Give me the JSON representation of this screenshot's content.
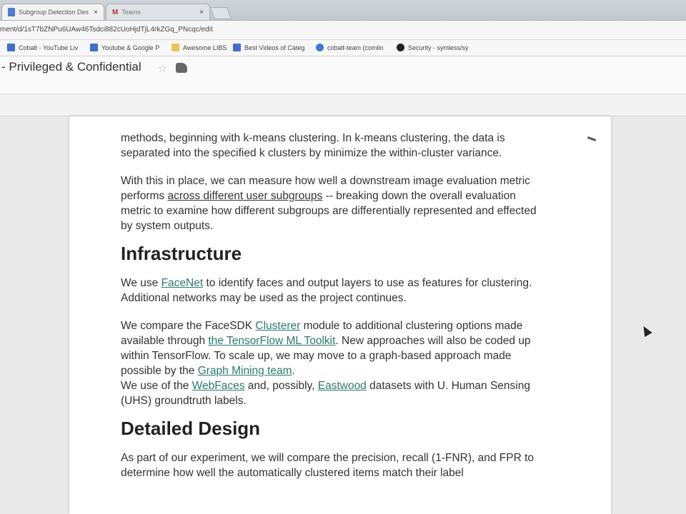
{
  "browser": {
    "tabs": [
      {
        "title": "Subgroup Detection Des",
        "close": "×"
      },
      {
        "title": "Teams",
        "close": "×"
      }
    ],
    "url": "ment/d/1sT7bZNPu6UAw46Tsdci882cUoHjdTjL4rkZGq_PNcqc/edit",
    "bookmarks": [
      {
        "label": "Cobalt - YouTube Liv"
      },
      {
        "label": "Youtube & Google P"
      },
      {
        "label": "Awesome LIBS"
      },
      {
        "label": "Best Videos of Categ"
      },
      {
        "label": "cobalt-team (comlin"
      },
      {
        "label": "Security - symless/sy"
      }
    ]
  },
  "doc": {
    "title": "- Privileged & Confidential",
    "p1": "methods, beginning with k-means clustering. In k-means clustering, the data is separated into the specified k clusters by minimize the within-cluster variance.",
    "p2_a": "With this in place, we can measure how well a downstream image evaluation metric performs ",
    "p2_link": "across different user subgroups",
    "p2_b": " -- breaking down the overall evaluation metric to examine how different subgroups are differentially represented and effected by system outputs.",
    "h_infra": "Infrastructure",
    "p3_a": "We use ",
    "p3_link": "FaceNet",
    "p3_b": " to identify faces and output layers to use as features for clustering.  Additional networks may be used as the project continues.",
    "p4_a": "We compare the FaceSDK ",
    "p4_link1": "Clusterer",
    "p4_b": " module to additional clustering options made available through ",
    "p4_link2": "the TensorFlow ML Toolkit",
    "p4_c": ".  New approaches will also be coded up within TensorFlow. To scale up, we may move to a graph-based approach made possible by the ",
    "p4_link3": "Graph Mining team",
    "p4_d": ".",
    "p5_a": "We use of the ",
    "p5_link1": "WebFaces",
    "p5_b": " and, possibly, ",
    "p5_link2": "Eastwood",
    "p5_c": " datasets with U. Human Sensing (UHS) groundtruth labels.",
    "h_design": "Detailed Design",
    "p6": "As part of our experiment, we will compare the precision, recall (1-FNR), and FPR to determine how well the automatically clustered items match their label"
  }
}
